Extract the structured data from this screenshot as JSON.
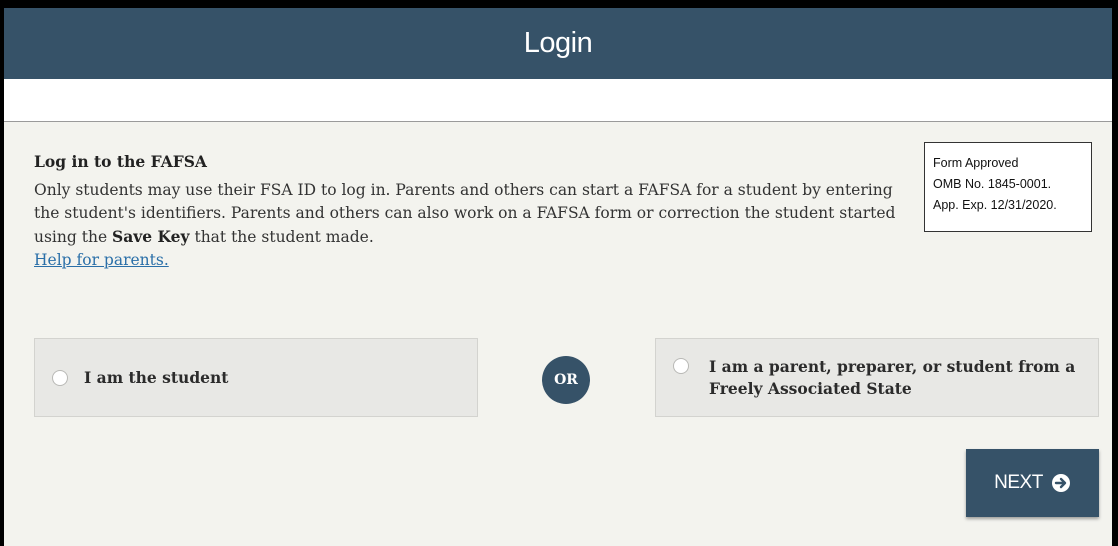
{
  "header": {
    "title": "Login"
  },
  "intro": {
    "title": "Log in to the FAFSA",
    "text_part1": "Only students may use their FSA ID to log in. Parents and others can start a FAFSA for a student by entering the student's identifiers. Parents and others can also work on a FAFSA form or correction the student started using the ",
    "text_bold": "Save Key",
    "text_part2": " that the student made.",
    "help_link": "Help for parents."
  },
  "omb": {
    "line1": "Form Approved",
    "line2": "OMB No. 1845-0001.",
    "line3": "App. Exp. 12/31/2020."
  },
  "options": {
    "student_label": "I am the student",
    "parent_label": "I am a parent, preparer, or student from a Freely Associated State",
    "or_label": "OR"
  },
  "actions": {
    "next_label": "NEXT"
  },
  "colors": {
    "header_bg": "#365268",
    "panel_bg": "#f3f3ee",
    "link": "#2a6fa8"
  },
  "icons": {
    "next": "arrow-right-circle-icon"
  }
}
